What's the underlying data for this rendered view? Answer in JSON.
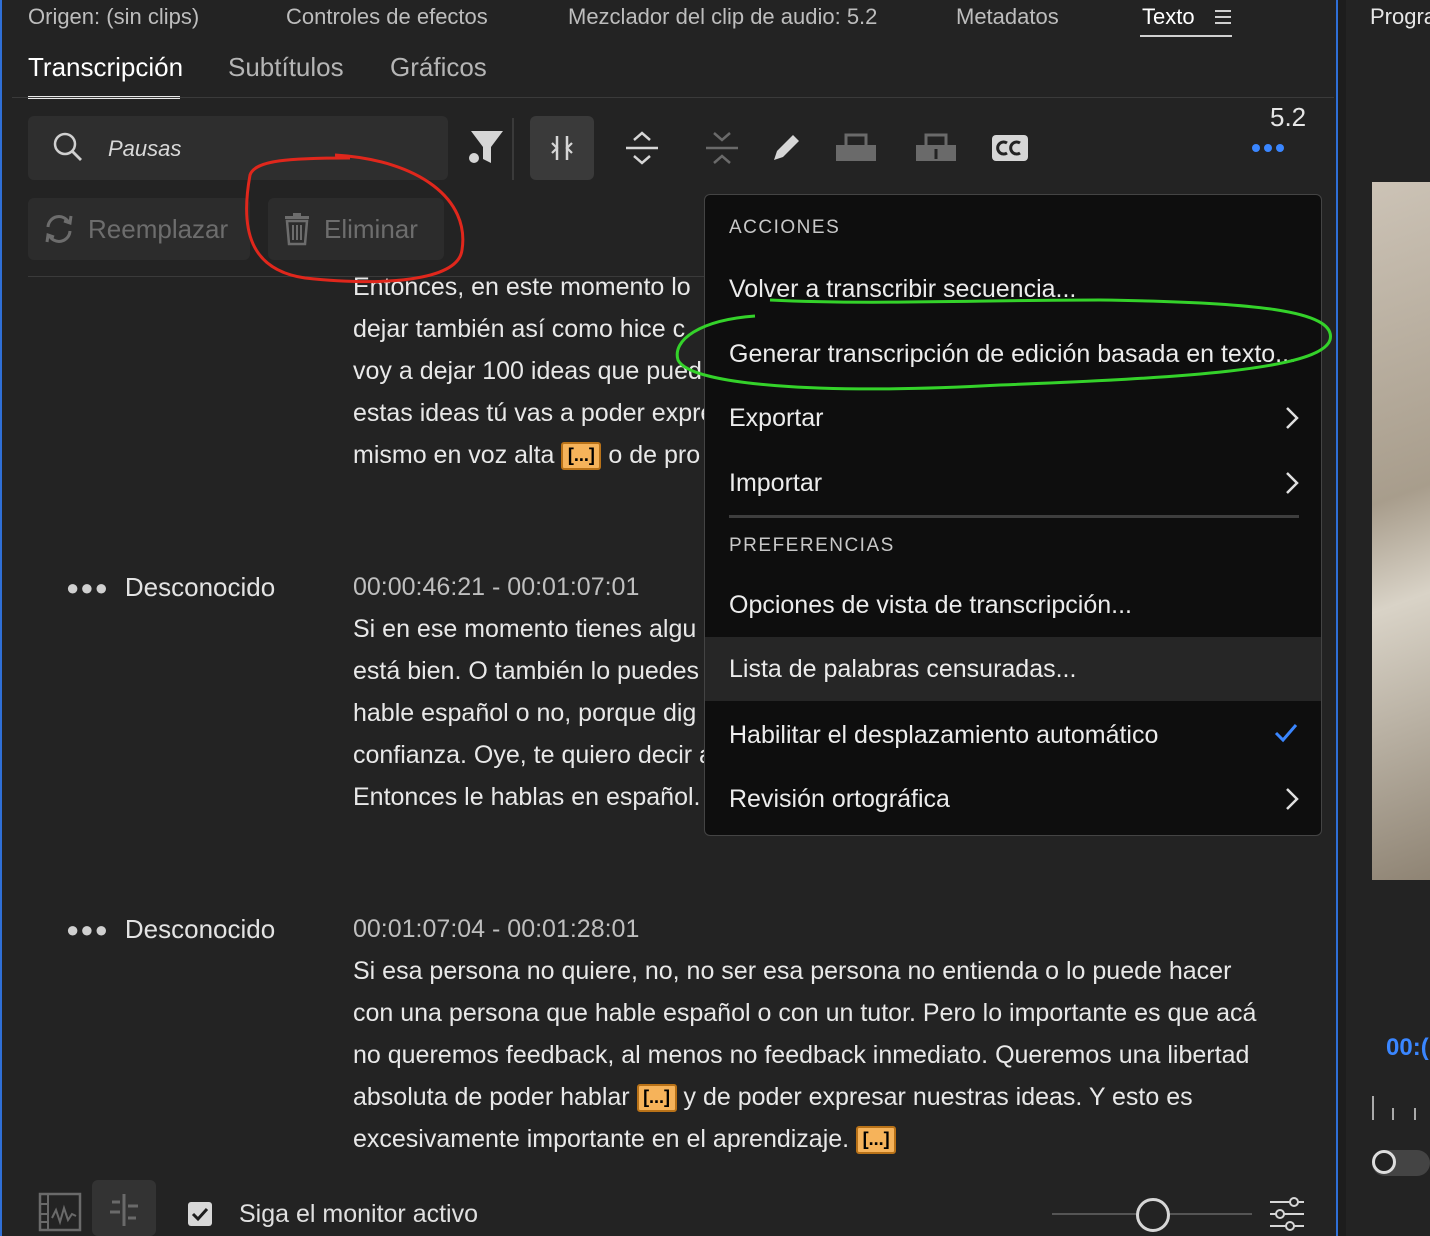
{
  "top_tabs": {
    "source": "Origen: (sin clips)",
    "effects": "Controles de efectos",
    "mixer": "Mezclador del clip de audio: 5.2",
    "metadata": "Metadatos",
    "text": "Texto"
  },
  "right_panel": {
    "title": "Progra",
    "timecode": "00:("
  },
  "sub_tabs": [
    "Transcripción",
    "Subtítulos",
    "Gráficos"
  ],
  "sequence_label": "5.2",
  "search": {
    "value": "Pausas"
  },
  "buttons": {
    "replace": "Reemplazar",
    "delete": "Eliminar"
  },
  "transcript": [
    {
      "speaker": "",
      "timecode": "",
      "lines": [
        "Entonces, en este momento lo",
        "dejar también así como hice c",
        "voy a dejar 100 ideas que pued",
        "estas ideas tú vas a poder expre",
        "mismo en voz alta",
        "o de pro"
      ]
    },
    {
      "speaker": "Desconocido",
      "timecode": "00:00:46:21 - 00:01:07:01",
      "lines": [
        "Si en ese momento tienes algu",
        "está bien. O también lo puedes",
        "hable español o no, porque dig",
        "confianza. Oye, te quiero decir a",
        "Entonces le hablas en español."
      ]
    },
    {
      "speaker": "Desconocido",
      "timecode": "00:01:07:04 - 00:01:28:01",
      "lines": [
        "Si esa persona no quiere, no, no ser esa persona no entienda o lo puede hacer",
        "con una persona que hable español o con un tutor. Pero lo importante es que acá",
        "no queremos feedback, al menos no feedback inmediato. Queremos una libertad",
        "absoluta de poder hablar",
        "y de poder expresar nuestras ideas. Y esto es",
        "excesivamente importante en el aprendizaje."
      ]
    }
  ],
  "pause_marker": "[...]",
  "menu": {
    "section_actions": "ACCIONES",
    "retranscribe": "Volver a transcribir secuencia...",
    "generate": "Generar transcripción de edición basada en texto...",
    "export": "Exportar",
    "import": "Importar",
    "section_prefs": "PREFERENCIAS",
    "view_options": "Opciones de vista de transcripción...",
    "censored": "Lista de palabras censuradas...",
    "autoscroll": "Habilitar el desplazamiento automático",
    "spellcheck": "Revisión ortográfica"
  },
  "bottom": {
    "follow_monitor": "Siga el monitor activo",
    "follow_checked": true
  },
  "colors": {
    "accent_blue": "#2f6fd6",
    "pause_orange": "#f6b35a",
    "check_blue": "#3a86ff"
  }
}
